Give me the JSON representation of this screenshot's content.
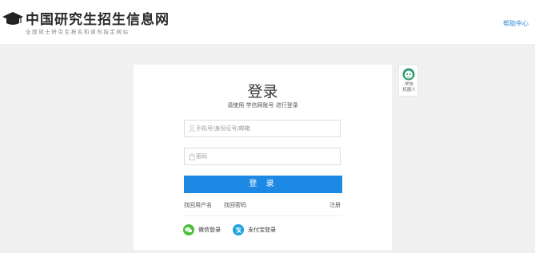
{
  "header": {
    "title": "中国研究生招生信息网",
    "subtitle": "全国硕士研究生报名和调剂指定网站",
    "help_link": "帮助中心"
  },
  "login": {
    "title": "登录",
    "subtitle": "请使用 学信网账号 进行登录",
    "username_placeholder": "手机号/身份证号/邮箱",
    "password_placeholder": "密码",
    "submit_label": "登 录",
    "forgot_username": "找回用户名",
    "forgot_password": "找回密码",
    "register": "注册",
    "social": [
      {
        "label": "微信登录",
        "icon": "wechat-icon",
        "color": "#4cbf3a"
      },
      {
        "label": "支付宝登录",
        "icon": "alipay-icon",
        "color": "#1ea3e0"
      }
    ]
  },
  "robot": {
    "label_line1": "学信",
    "label_line2": "机器人",
    "icon": "robot-icon"
  },
  "colors": {
    "accent": "#1e88e5",
    "background": "#f0f0f0",
    "link": "#2a8ad8"
  }
}
